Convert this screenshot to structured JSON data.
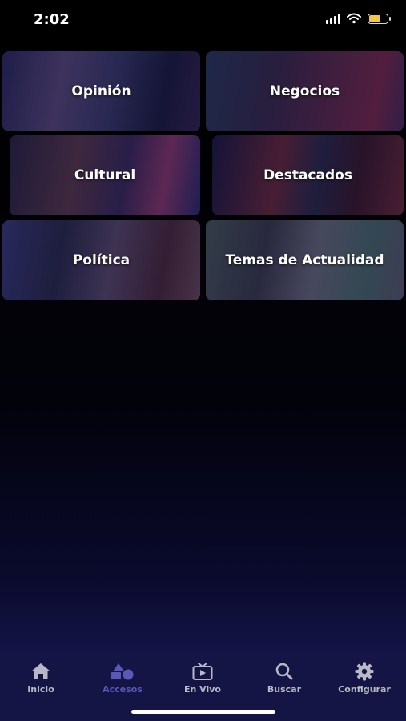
{
  "status_bar": {
    "time": "2:02",
    "battery_color": "#f2c744"
  },
  "categories": [
    {
      "label": "Opinión"
    },
    {
      "label": "Negocios"
    },
    {
      "label": "Cultural"
    },
    {
      "label": "Destacados"
    },
    {
      "label": "Política"
    },
    {
      "label": "Temas de Actualidad"
    }
  ],
  "tabbar": {
    "active_color": "#5858b8",
    "inactive_color": "#b8b8c8",
    "tabs": [
      {
        "label": "Inicio",
        "icon": "home-icon"
      },
      {
        "label": "Accesos",
        "icon": "shapes-icon"
      },
      {
        "label": "En Vivo",
        "icon": "tv-icon"
      },
      {
        "label": "Buscar",
        "icon": "search-icon"
      },
      {
        "label": "Configurar",
        "icon": "gear-icon"
      }
    ]
  }
}
